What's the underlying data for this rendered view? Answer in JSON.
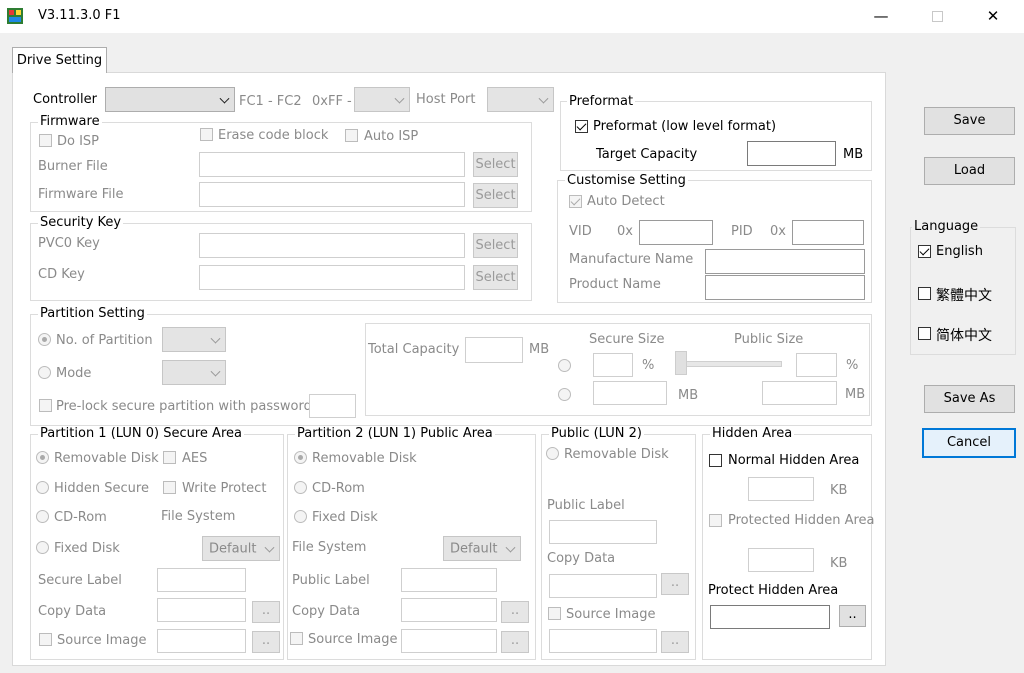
{
  "window": {
    "title": "V3.11.3.0 F1",
    "minimize": "—",
    "close": "✕"
  },
  "tab": {
    "label": "Drive Setting"
  },
  "controller": {
    "label": "Controller",
    "range": "FC1 - FC2",
    "hex": "0xFF -",
    "host_port": "Host Port"
  },
  "firmware": {
    "title": "Firmware",
    "do_isp": "Do ISP",
    "erase_code_block": "Erase code block",
    "auto_isp": "Auto ISP",
    "burner_file": "Burner File",
    "firmware_file": "Firmware File",
    "select": "Select"
  },
  "security_key": {
    "title": "Security Key",
    "pvc0_key": "PVC0 Key",
    "cd_key": "CD Key",
    "select": "Select"
  },
  "partition": {
    "title": "Partition Setting",
    "no_of_partition": "No. of Partition",
    "mode": "Mode",
    "prelock": "Pre-lock secure partition with password :",
    "total_capacity": "Total Capacity",
    "mb": "MB",
    "secure_size": "Secure Size",
    "public_size": "Public Size",
    "pct": "%"
  },
  "lun0": {
    "title": "Partition 1 (LUN 0) Secure Area",
    "removable_disk": "Removable Disk",
    "aes": "AES",
    "hidden_secure": "Hidden Secure",
    "write_protect": "Write Protect",
    "cd_rom": "CD-Rom",
    "file_system": "File System",
    "fixed_disk": "Fixed Disk",
    "fs_value": "Default",
    "secure_label": "Secure Label",
    "copy_data": "Copy Data",
    "source_image": "Source Image",
    "browse": ".."
  },
  "lun1": {
    "title": "Partition 2 (LUN 1) Public Area",
    "removable_disk": "Removable Disk",
    "cd_rom": "CD-Rom",
    "fixed_disk": "Fixed Disk",
    "file_system": "File System",
    "fs_value": "Default",
    "public_label": "Public Label",
    "copy_data": "Copy Data",
    "source_image": "Source Image",
    "browse": ".."
  },
  "lun2": {
    "title": "Public (LUN 2)",
    "removable_disk": "Removable Disk",
    "public_label": "Public Label",
    "copy_data": "Copy Data",
    "source_image": "Source Image",
    "browse": ".."
  },
  "hidden_area": {
    "title": "Hidden Area",
    "normal": "Normal Hidden Area",
    "kb": "KB",
    "protected": "Protected Hidden Area",
    "protect_label": "Protect Hidden Area",
    "browse": ".."
  },
  "preformat": {
    "title": "Preformat",
    "checkbox": "Preformat (low level format)",
    "target_capacity": "Target Capacity",
    "mb": "MB"
  },
  "customise": {
    "title": "Customise Setting",
    "auto_detect": "Auto Detect",
    "vid": "VID",
    "pid": "PID",
    "hex": "0x",
    "manufacture_name": "Manufacture Name",
    "product_name": "Product Name"
  },
  "buttons": {
    "save": "Save",
    "load": "Load",
    "save_as": "Save As",
    "cancel": "Cancel"
  },
  "language": {
    "title": "Language",
    "english": "English",
    "traditional": "繁體中文",
    "simplified": "简体中文"
  },
  "colors": {
    "cancel_border": "#0078d7"
  }
}
